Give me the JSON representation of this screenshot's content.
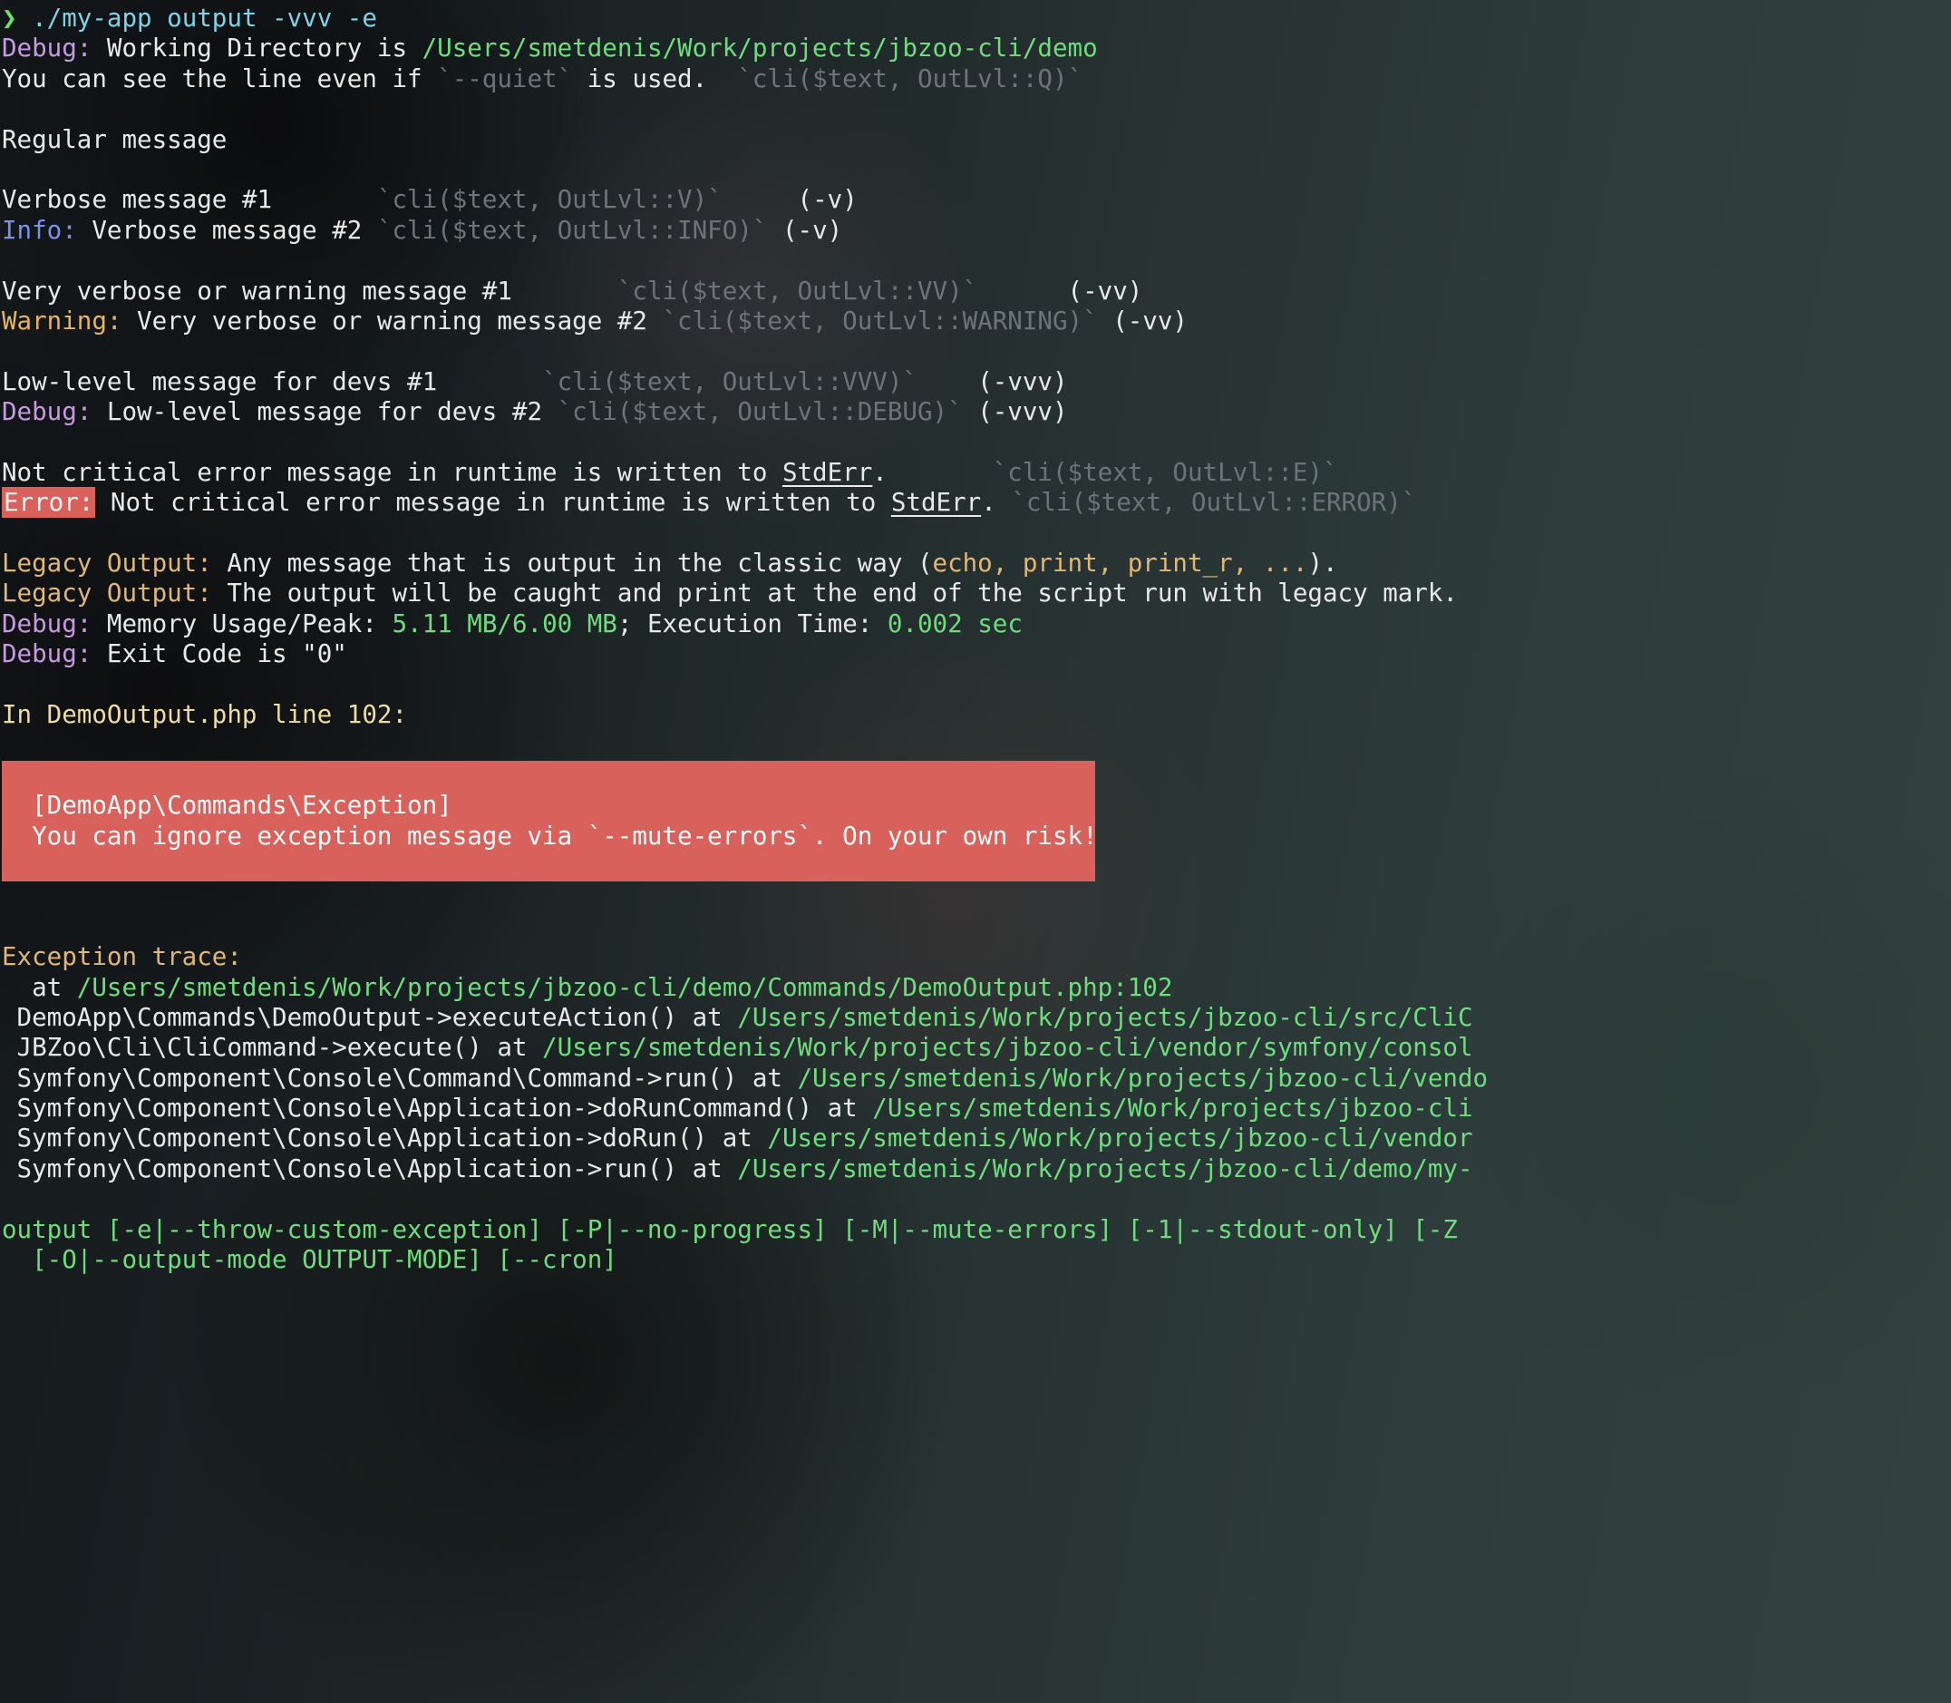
{
  "terminal": {
    "title": "terminal-output",
    "colors": {
      "background": "#2e3c3c",
      "foreground": "#e8e8e8",
      "prompt": "#69e36b",
      "command": "#7fd3e8",
      "debug": "#c69ae0",
      "info": "#7b91e8",
      "warning": "#e6b463",
      "legacy": "#e0b776",
      "green": "#6fdc7e",
      "dim_comment": "#6d7378",
      "error_background": "#d9615c",
      "exception_background": "#d9615c",
      "yellow": "#f0dba0"
    },
    "prompt_symbol": "❯",
    "command": "./my-app output -vvv -e"
  },
  "lines": {
    "debug_cwd_label": "Debug:",
    "debug_cwd_text": " Working Directory is ",
    "debug_cwd_path": "/Users/smetdenis/Work/projects/jbzoo-cli/demo",
    "quiet_line_a": "You can see the line even if ",
    "quiet_line_code": "`--quiet`",
    "quiet_line_b": " is used.  ",
    "quiet_line_hint": "`cli($text, OutLvl::Q)`",
    "regular_message": "Regular message",
    "verbose1_text": "Verbose message #1",
    "verbose1_hint": "`cli($text, OutLvl::V)`",
    "verbose1_flag": "(-v)",
    "info_label": "Info:",
    "info_text": " Verbose message #2 ",
    "info_hint": "`cli($text, OutLvl::INFO)`",
    "info_flag": "(-v)",
    "vverbose1_text": "Very verbose or warning message #1",
    "vverbose1_hint": "`cli($text, OutLvl::VV)`",
    "vverbose1_flag": "(-vv)",
    "warning_label": "Warning:",
    "warning_text": " Very verbose or warning message #2 ",
    "warning_hint": "`cli($text, OutLvl::WARNING)`",
    "warning_flag": "(-vv)",
    "lowlevel1_text": "Low-level message for devs #1",
    "lowlevel1_hint": "`cli($text, OutLvl::VVV)`",
    "lowlevel1_flag": "(-vvv)",
    "debug_low_label": "Debug:",
    "debug_low_text": " Low-level message for devs #2 ",
    "debug_low_hint": "`cli($text, OutLvl::DEBUG)`",
    "debug_low_flag": "(-vvv)",
    "err_plain_a": "Not critical error message in runtime is written to ",
    "err_plain_stderr": "StdErr",
    "err_plain_b": ".",
    "err_plain_hint": "`cli($text, OutLvl::E)`",
    "error_label": "Error:",
    "error_text_a": " Not critical error message in runtime is written to ",
    "error_stderr": "StdErr",
    "error_text_b": ". ",
    "error_hint": "`cli($text, OutLvl::ERROR)`",
    "legacy1_label": "Legacy Output:",
    "legacy1_text_a": " Any message that is output in the classic way (",
    "legacy1_text_code": "echo, print, print_r, ...",
    "legacy1_text_b": ").",
    "legacy2_label": "Legacy Output:",
    "legacy2_text": " The output will be caught and print at the end of the script run with legacy mark.",
    "mem_label": "Debug:",
    "mem_text_a": " Memory Usage/Peak: ",
    "mem_value_used": "5.11 MB",
    "mem_sep": "/",
    "mem_value_peak": "6.00 MB",
    "mem_text_b": "; Execution Time: ",
    "mem_value_time": "0.002 sec",
    "exit_label": "Debug:",
    "exit_text": " Exit Code is \"0\"",
    "exception_header": "In DemoOutput.php line 102:",
    "exception_class": "  [DemoApp\\Commands\\Exception]",
    "exception_message": "  You can ignore exception message via `--mute-errors`. On your own risk!",
    "trace_header": "Exception trace:",
    "trace_1_prefix": "  at ",
    "trace_1_path": "/Users/smetdenis/Work/projects/jbzoo-cli/demo/Commands/DemoOutput.php:102",
    "trace_2_call": " DemoApp\\Commands\\DemoOutput->executeAction() at ",
    "trace_2_path": "/Users/smetdenis/Work/projects/jbzoo-cli/src/CliC",
    "trace_3_call": " JBZoo\\Cli\\CliCommand->execute() at ",
    "trace_3_path": "/Users/smetdenis/Work/projects/jbzoo-cli/vendor/symfony/consol",
    "trace_4_call": " Symfony\\Component\\Console\\Command\\Command->run() at ",
    "trace_4_path": "/Users/smetdenis/Work/projects/jbzoo-cli/vendo",
    "trace_5_call": " Symfony\\Component\\Console\\Application->doRunCommand() at ",
    "trace_5_path": "/Users/smetdenis/Work/projects/jbzoo-cli",
    "trace_6_call": " Symfony\\Component\\Console\\Application->doRun() at ",
    "trace_6_path": "/Users/smetdenis/Work/projects/jbzoo-cli/vendor",
    "trace_7_call": " Symfony\\Component\\Console\\Application->run() at ",
    "trace_7_path": "/Users/smetdenis/Work/projects/jbzoo-cli/demo/my-",
    "usage_1": "output [-e|--throw-custom-exception] [-P|--no-progress] [-M|--mute-errors] [-1|--stdout-only] [-Z",
    "usage_2": "  [-O|--output-mode OUTPUT-MODE] [--cron]"
  }
}
